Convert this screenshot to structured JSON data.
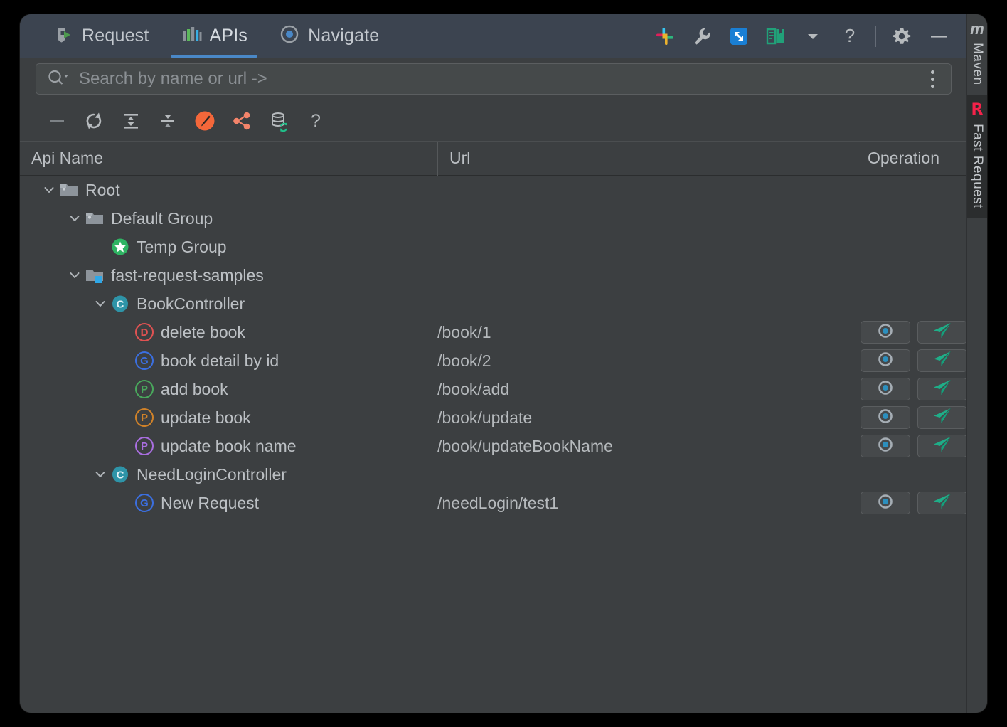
{
  "window": {
    "title": "Fast Request"
  },
  "tabs": [
    {
      "label": "Request",
      "icon": "shield-play-icon",
      "active": false
    },
    {
      "label": "APIs",
      "icon": "bar-chart-icon",
      "active": true
    },
    {
      "label": "Navigate",
      "icon": "target-circle-icon",
      "active": false
    }
  ],
  "titlebar_icons": [
    {
      "name": "slack-icon",
      "title": "Slack"
    },
    {
      "name": "wrench-icon",
      "title": "Tools"
    },
    {
      "name": "expand-window-icon",
      "title": "Expand"
    },
    {
      "name": "book-icon",
      "title": "Documentation"
    },
    {
      "name": "chevron-down-icon",
      "title": "More"
    },
    {
      "name": "help-question-icon",
      "title": "Help"
    },
    {
      "name": "gear-icon",
      "title": "Settings"
    },
    {
      "name": "minimize-icon",
      "title": "Hide"
    }
  ],
  "search": {
    "placeholder": "Search by name or url ->",
    "value": "",
    "icon": "search-magnifier-icon",
    "menu_icon": "kebab-menu-icon"
  },
  "toolbar": [
    {
      "name": "collapse-panel-button",
      "icon": "minus-icon"
    },
    {
      "name": "refresh-button",
      "icon": "refresh-icon"
    },
    {
      "name": "expand-all-button",
      "icon": "expand-all-icon"
    },
    {
      "name": "collapse-all-button",
      "icon": "collapse-all-icon"
    },
    {
      "name": "edit-pen-button",
      "icon": "orange-pen-icon"
    },
    {
      "name": "share-button",
      "icon": "share-nodes-icon"
    },
    {
      "name": "sync-database-button",
      "icon": "database-sync-icon"
    },
    {
      "name": "toolbar-help-button",
      "icon": "question-mark-icon"
    }
  ],
  "columns": {
    "name": "Api Name",
    "url": "Url",
    "operation": "Operation"
  },
  "tree": [
    {
      "label": "Root",
      "depth": 0,
      "type": "folder",
      "icon": "folder-icon",
      "expanded": true,
      "url": "",
      "has_ops": false
    },
    {
      "label": "Default Group",
      "depth": 1,
      "type": "folder",
      "icon": "folder-icon",
      "expanded": true,
      "url": "",
      "has_ops": false
    },
    {
      "label": "Temp Group",
      "depth": 2,
      "type": "temp-group",
      "icon": "green-star-icon",
      "expanded": null,
      "url": "",
      "has_ops": false
    },
    {
      "label": "fast-request-samples",
      "depth": 1,
      "type": "module",
      "icon": "module-folder-icon",
      "expanded": true,
      "url": "",
      "has_ops": false
    },
    {
      "label": "BookController",
      "depth": 2,
      "type": "class",
      "icon": "class-c-icon",
      "expanded": true,
      "url": "",
      "has_ops": false
    },
    {
      "label": "delete book",
      "depth": 3,
      "type": "api",
      "method": "D",
      "method_color": "#e05252",
      "url": "/book/1",
      "has_ops": true
    },
    {
      "label": "book detail by id",
      "depth": 3,
      "type": "api",
      "method": "G",
      "method_color": "#3b6fe0",
      "url": "/book/2",
      "has_ops": true
    },
    {
      "label": "add book",
      "depth": 3,
      "type": "api",
      "method": "P",
      "method_color": "#49a85c",
      "url": "/book/add",
      "has_ops": true
    },
    {
      "label": "update book",
      "depth": 3,
      "type": "api",
      "method": "P",
      "method_color": "#d08229",
      "url": "/book/update",
      "has_ops": true
    },
    {
      "label": "update book name",
      "depth": 3,
      "type": "api",
      "method": "P",
      "method_color": "#a96ee0",
      "url": "/book/updateBookName",
      "has_ops": true
    },
    {
      "label": "NeedLoginController",
      "depth": 2,
      "type": "class",
      "icon": "class-c-icon",
      "expanded": true,
      "url": "",
      "has_ops": false
    },
    {
      "label": "New Request",
      "depth": 3,
      "type": "api",
      "method": "G",
      "method_color": "#3b6fe0",
      "url": "/needLogin/test1",
      "has_ops": true
    }
  ],
  "row_operations": {
    "locate": {
      "name": "locate-api-button",
      "icon": "target-dot-icon"
    },
    "send": {
      "name": "send-request-button",
      "icon": "send-plane-icon"
    }
  },
  "right_sidebar": [
    {
      "label": "Maven",
      "logo": "m",
      "logo_type": "maven-logo",
      "active": false
    },
    {
      "label": "Fast Request",
      "logo": "R",
      "logo_type": "fast-request-logo",
      "active": true
    }
  ],
  "colors": {
    "accent_blue": "#4a88c7",
    "tabbar_bg": "#3c4450",
    "panel_bg": "#3c3f41",
    "active_sidebar_bg": "#2b2d2e",
    "fast_request_red": "#f5224a",
    "send_green": "#1fae88",
    "orange": "#f4673a"
  }
}
